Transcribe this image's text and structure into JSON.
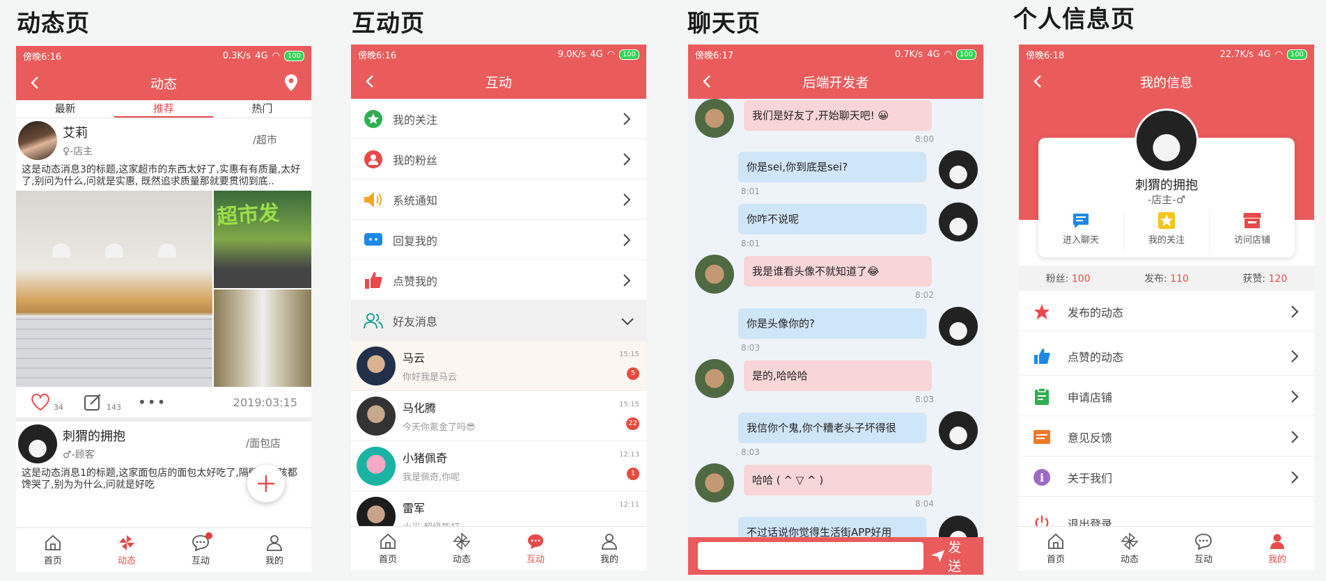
{
  "titles": [
    "动态页",
    "互动页",
    "聊天页",
    "个人信息页"
  ],
  "status": [
    {
      "time": "傍晚6:16",
      "speed": "0.3K/s",
      "batt": "100"
    },
    {
      "time": "傍晚6:16",
      "speed": "9.0K/s",
      "batt": "100"
    },
    {
      "time": "傍晚6:17",
      "speed": "0.7K/s",
      "batt": "100"
    },
    {
      "time": "傍晚6:18",
      "speed": "22.7K/s",
      "batt": "100"
    }
  ],
  "network": "4G",
  "tabbar": [
    "首页",
    "动态",
    "互动",
    "我的"
  ],
  "feed": {
    "title": "动态",
    "tabs": [
      "最新",
      "推荐",
      "热门"
    ],
    "post1": {
      "name": "艾莉",
      "role": "♀-店主",
      "tag": "/超市",
      "text": "这是动态消息3的标题,这家超市的东西太好了,实惠有有质量,太好了,别问为什么,问就是实惠, 既然追求质量那就要贯彻到底..",
      "likes": "34",
      "comments": "143",
      "date": "2019:03:15",
      "sign": "超市发"
    },
    "post2": {
      "name": "刺猬的拥抱",
      "role": "♂-顾客",
      "tag": "/面包店",
      "text": "这是动态消息1的标题,这家面包店的面包太好吃了,隔壁的小孩都馋哭了,别为为什么,问就是好吃"
    }
  },
  "interact": {
    "title": "互动",
    "menu": [
      "我的关注",
      "我的粉丝",
      "系统通知",
      "回复我的",
      "点赞我的"
    ],
    "friends_label": "好友消息",
    "friends": [
      {
        "name": "马云",
        "msg": "你好我是马云",
        "time": "15:15",
        "badge": "5"
      },
      {
        "name": "马化腾",
        "msg": "今天你氪金了吗😎",
        "time": "15:15",
        "badge": "22"
      },
      {
        "name": "小猪佩奇",
        "msg": "我是佩奇,你呢",
        "time": "12:13",
        "badge": "1"
      },
      {
        "name": "雷军",
        "msg": "小米,超级能打",
        "time": "12:11",
        "badge": ""
      }
    ]
  },
  "chat": {
    "title": "后端开发者",
    "messages": [
      {
        "side": "l",
        "text": "我们是好友了,开始聊天吧! 😀",
        "time": "8:00"
      },
      {
        "side": "r",
        "text": "你是sei,你到底是sei?",
        "time": "8:01"
      },
      {
        "side": "r",
        "text": "你咋不说呢",
        "time": "8:01"
      },
      {
        "side": "l",
        "text": "我是谁看头像不就知道了😂",
        "time": "8:02"
      },
      {
        "side": "r",
        "text": "你是头像你的?",
        "time": "8:03"
      },
      {
        "side": "l",
        "text": "是的,哈哈哈",
        "time": "8:03"
      },
      {
        "side": "r",
        "text": "我信你个鬼,你个糟老头子坏得很",
        "time": "8:03"
      },
      {
        "side": "l",
        "text": "哈哈 ( ^ ▽ ^ )",
        "time": "8:04"
      },
      {
        "side": "r",
        "text": "不过话说你觉得生活街APP好用",
        "time": ""
      }
    ],
    "send": "发送"
  },
  "profile": {
    "title": "我的信息",
    "name": "刺猬的拥抱",
    "role": "-店主-♂",
    "actions": [
      "进入聊天",
      "我的关注",
      "访问店铺"
    ],
    "stats": [
      {
        "k": "粉丝:",
        "v": "100"
      },
      {
        "k": "发布:",
        "v": "110"
      },
      {
        "k": "获赞:",
        "v": "120"
      }
    ],
    "menu": [
      "发布的动态",
      "点赞的动态",
      "申请店铺",
      "意见反馈",
      "关于我们",
      "退出登录"
    ]
  },
  "colors": {
    "brand": "#ea5b5c",
    "accent": "#e84a4a",
    "chat_left": "#f8d5d6",
    "chat_right": "#cfe5f8"
  }
}
